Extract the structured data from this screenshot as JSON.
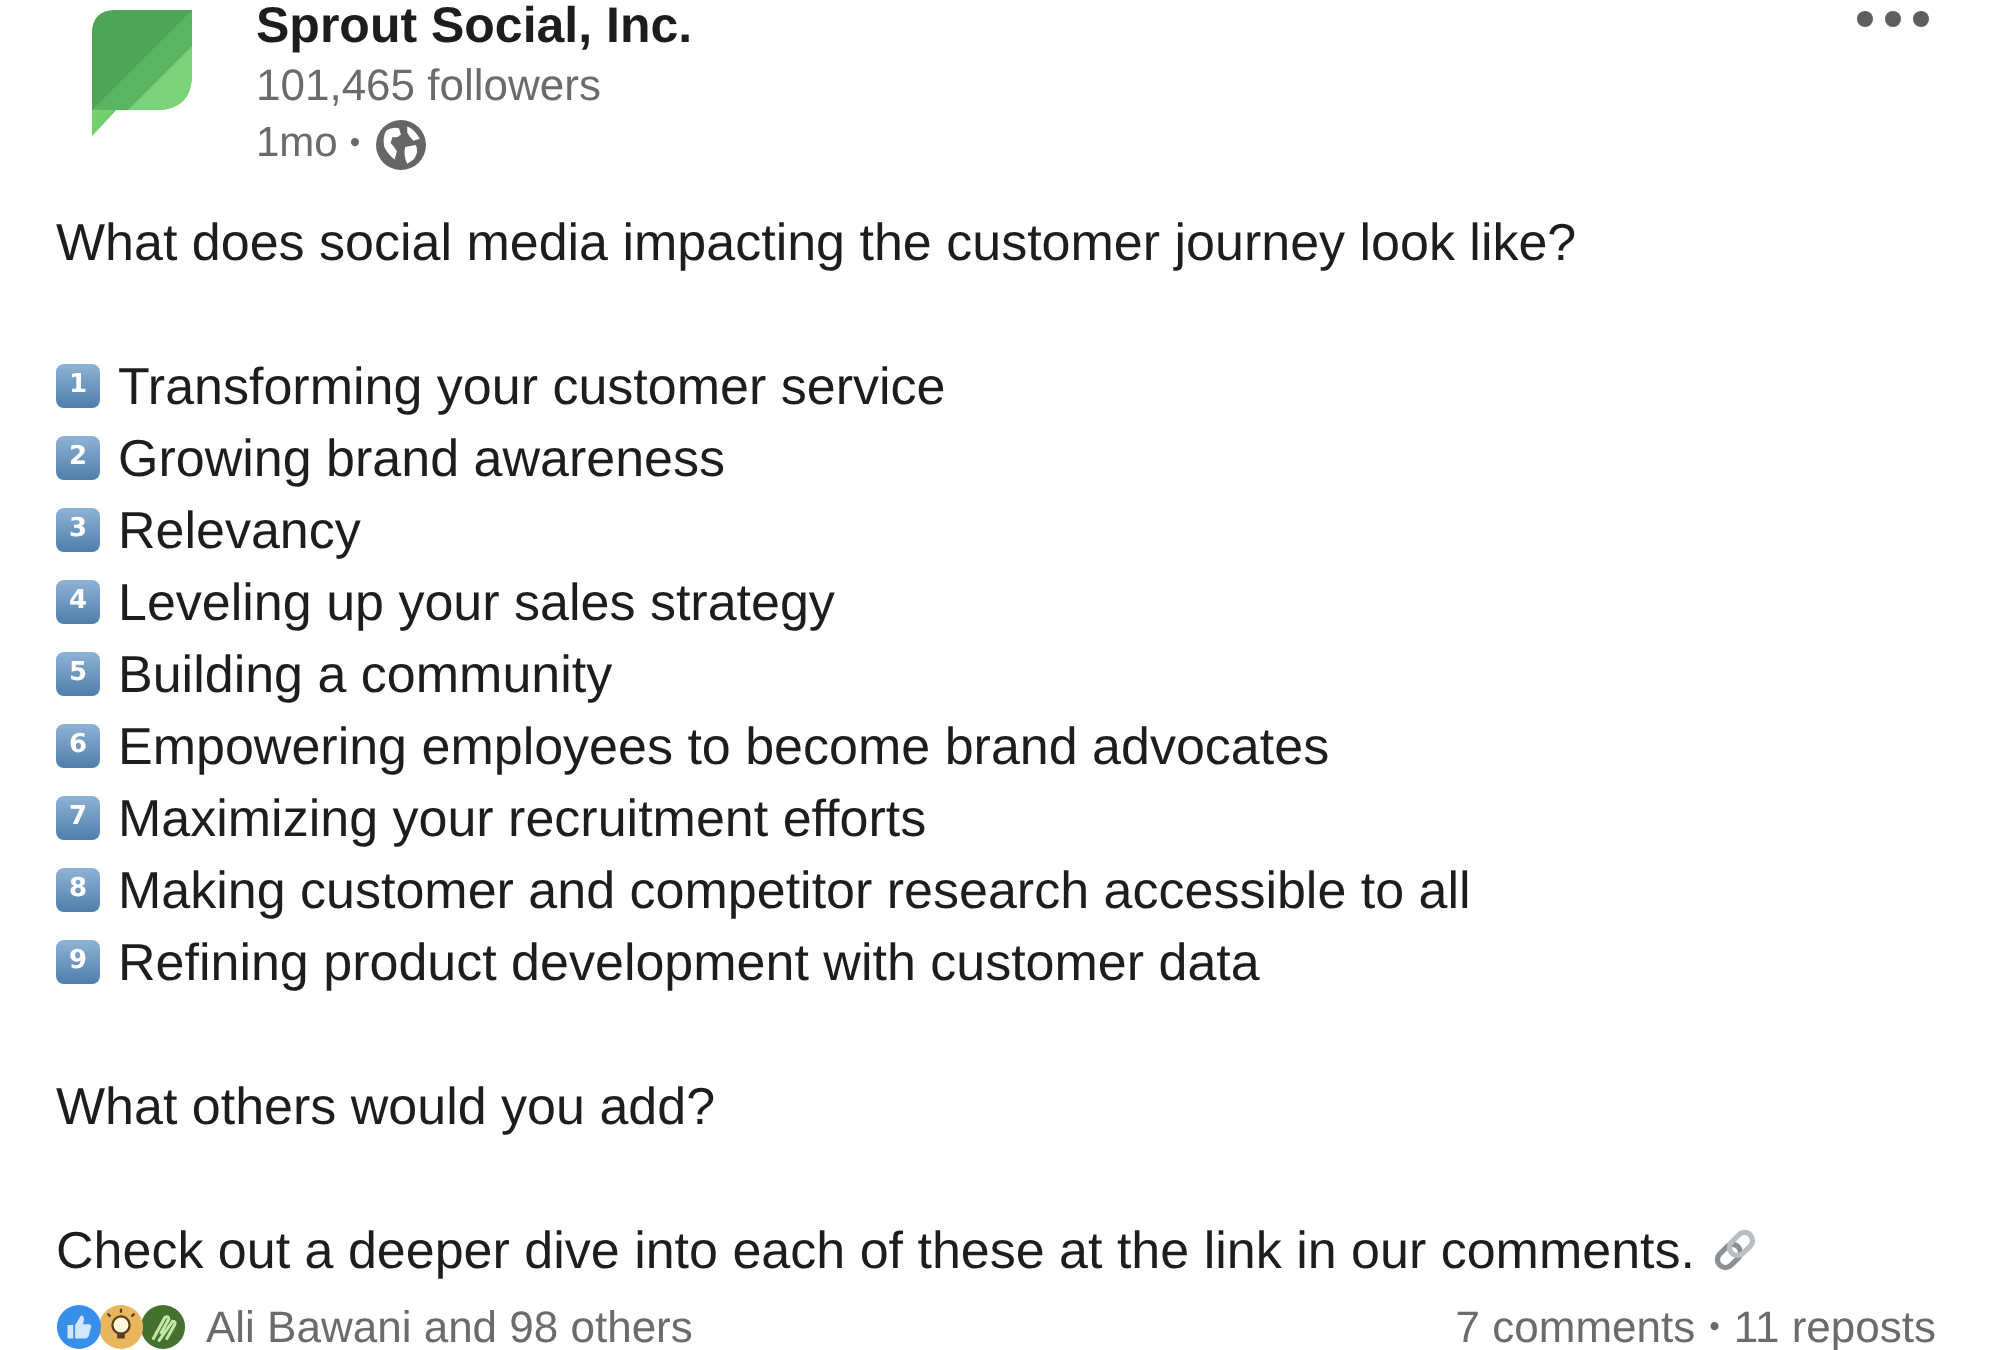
{
  "post": {
    "author": "Sprout Social, Inc.",
    "followers": "101,465 followers",
    "time": "1mo",
    "separator": "•"
  },
  "intro": "What does social media impacting the customer journey look like?",
  "list": [
    {
      "number": "1",
      "text": "Transforming your customer service"
    },
    {
      "number": "2",
      "text": "Growing brand awareness"
    },
    {
      "number": "3",
      "text": "Relevancy"
    },
    {
      "number": "4",
      "text": "Leveling up your sales strategy"
    },
    {
      "number": "5",
      "text": "Building a community"
    },
    {
      "number": "6",
      "text": "Empowering employees to become brand advocates"
    },
    {
      "number": "7",
      "text": "Maximizing your recruitment efforts"
    },
    {
      "number": "8",
      "text": "Making customer and competitor research accessible to all"
    },
    {
      "number": "9",
      "text": "Refining product development with customer data"
    }
  ],
  "question": "What others would you add?",
  "closing": "Check out a deeper dive into each of these at the link in our comments.",
  "reactions": {
    "summary": "Ali Bawani and 98 others",
    "comments": "7 comments",
    "separator": "•",
    "reposts": "11 reposts"
  }
}
